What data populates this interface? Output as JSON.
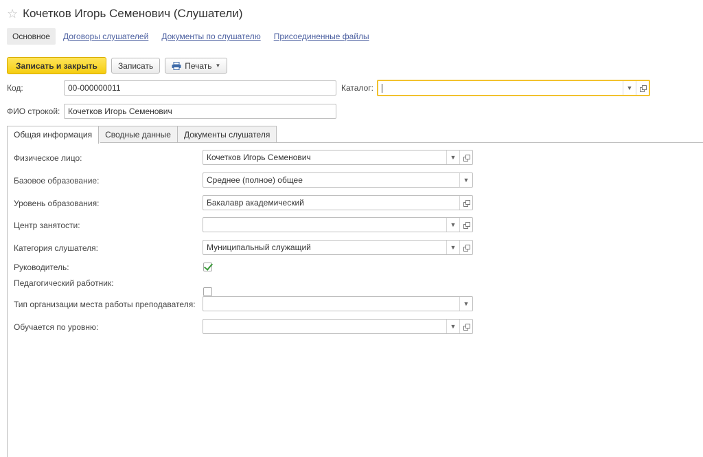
{
  "window": {
    "title": "Кочетков Игорь Семенович (Слушатели)"
  },
  "nav": {
    "items": [
      {
        "label": "Основное"
      },
      {
        "label": "Договоры слушателей"
      },
      {
        "label": "Документы по слушателю"
      },
      {
        "label": "Присоединенные файлы"
      }
    ]
  },
  "toolbar": {
    "save_close_label": "Записать и закрыть",
    "save_label": "Записать",
    "print_label": "Печать"
  },
  "header_fields": {
    "code_label": "Код:",
    "code_value": "00-000000011",
    "catalog_label": "Каталог:",
    "catalog_value": "",
    "fio_label": "ФИО строкой:",
    "fio_value": "Кочетков Игорь Семенович"
  },
  "tabs": [
    {
      "label": "Общая информация"
    },
    {
      "label": "Сводные данные"
    },
    {
      "label": "Документы слушателя"
    }
  ],
  "form": {
    "physical_person": {
      "label": "Физическое лицо:",
      "value": "Кочетков Игорь Семенович"
    },
    "base_education": {
      "label": "Базовое образование:",
      "value": "Среднее (полное) общее"
    },
    "education_level": {
      "label": "Уровень образования:",
      "value": "Бакалавр академический"
    },
    "employment_center": {
      "label": "Центр занятости:",
      "value": ""
    },
    "listener_category": {
      "label": "Категория слушателя:",
      "value": "Муниципальный служащий"
    },
    "manager": {
      "label": "Руководитель:",
      "checked": true
    },
    "pedagogical_worker": {
      "label": "Педагогический работник:",
      "checked": false
    },
    "org_type": {
      "label": "Тип организации места работы преподавателя:",
      "value": ""
    },
    "studies_level": {
      "label": "Обучается по уровню:",
      "value": ""
    }
  },
  "colors": {
    "accent_button": "#f5cd10",
    "focus_border": "#f2c22e",
    "link": "#4b5fa0",
    "check_mark": "#3a9a3a"
  }
}
